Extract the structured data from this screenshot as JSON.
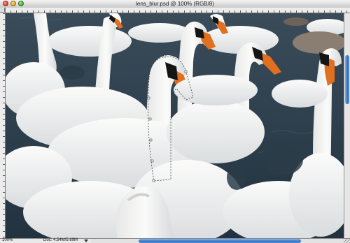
{
  "window": {
    "title": "lens_blur.psd @ 100% (RGB/8)"
  },
  "statusbar": {
    "zoom": "100%",
    "doc_info": "Doc: 4.54M/5.69M"
  },
  "colors": {
    "water": "#2c3f4e",
    "swan_white": "#f2f2f0",
    "beak_orange": "#e0701f",
    "scroll_blue": "#2f70c6"
  },
  "icons": {
    "close": "close-traffic-light-icon",
    "minimize": "minimize-traffic-light-icon",
    "maximize": "zoom-traffic-light-icon",
    "status_menu": "triangle-down-icon",
    "resize": "resize-grip-icon"
  }
}
